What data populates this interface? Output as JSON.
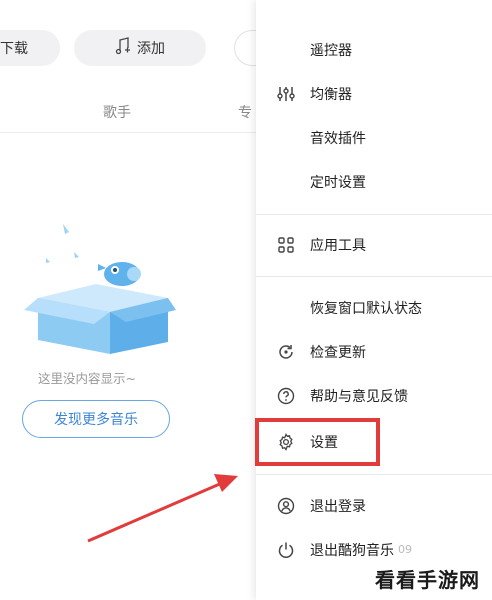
{
  "toolbar": {
    "download_label": "下载",
    "add_label": "添加"
  },
  "tabs": {
    "artist": "歌手",
    "album": "专"
  },
  "empty_state": {
    "text": "这里没内容显示~",
    "button": "发现更多音乐"
  },
  "menu": {
    "items": [
      {
        "label": "遥控器",
        "icon": "none"
      },
      {
        "label": "均衡器",
        "icon": "equalizer-icon"
      },
      {
        "label": "音效插件",
        "icon": "none"
      },
      {
        "label": "定时设置",
        "icon": "none"
      },
      {
        "label": "应用工具",
        "icon": "grid-icon"
      },
      {
        "label": "恢复窗口默认状态",
        "icon": "none"
      },
      {
        "label": "检查更新",
        "icon": "refresh-icon"
      },
      {
        "label": "帮助与意见反馈",
        "icon": "help-icon"
      },
      {
        "label": "设置",
        "icon": "gear-icon"
      },
      {
        "label": "退出登录",
        "icon": "user-icon"
      },
      {
        "label": "退出酷狗音乐",
        "icon": "power-icon"
      }
    ]
  },
  "faint_text": "09",
  "watermark": "看看手游网",
  "colors": {
    "highlight": "#e23b3b",
    "accent_blue": "#3d86d6",
    "box_blue": "#8ecbf2"
  }
}
